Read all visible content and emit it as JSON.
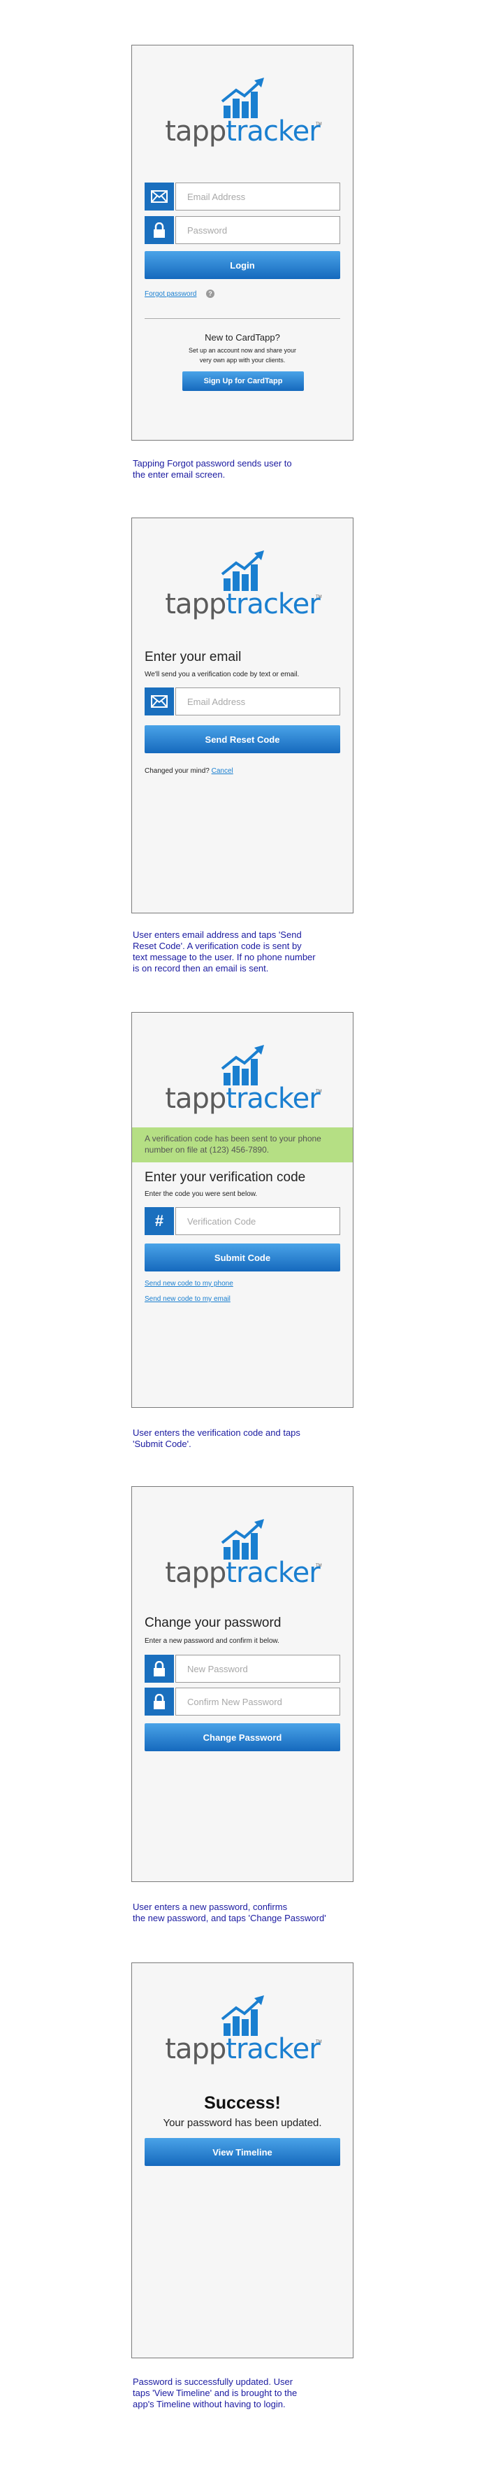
{
  "brand": {
    "part1": "tapp",
    "part2": "tracker",
    "tm": "TM"
  },
  "screen1": {
    "email_placeholder": "Email Address",
    "password_placeholder": "Password",
    "login_label": "Login",
    "forgot_label": "Forgot password",
    "new_title": "New to CardTapp?",
    "new_desc_1": "Set up an account now and share your",
    "new_desc_2": "very own app with your clients.",
    "signup_label": "Sign Up for CardTapp"
  },
  "caption1": "Tapping Forgot password sends user to\nthe enter email screen.",
  "screen2": {
    "heading": "Enter your email",
    "subtext": "We'll send you a verification code by text or email.",
    "email_placeholder": "Email Address",
    "send_label": "Send Reset Code",
    "changed_text": "Changed your mind?",
    "cancel_label": "Cancel"
  },
  "caption2": "User enters email address and taps 'Send\nReset Code'. A verification code is sent by\ntext message to the user. If no phone number\nis on record then an email is sent.",
  "screen3": {
    "banner": "A verification code has been sent to your phone number on file at (123) 456-7890.",
    "heading": "Enter your verification code",
    "subtext": "Enter the code you were sent below.",
    "code_placeholder": "Verification Code",
    "submit_label": "Submit Code",
    "resend_phone": "Send new code to my phone",
    "resend_email": "Send new code to my email"
  },
  "caption3": "User enters the verification code and taps\n'Submit Code'.",
  "screen4": {
    "heading": "Change your password",
    "subtext": "Enter a new password and confirm it below.",
    "new_placeholder": "New Password",
    "confirm_placeholder": "Confirm New Password",
    "change_label": "Change Password"
  },
  "caption4": "User enters a new password, confirms\nthe new password, and taps 'Change Password'",
  "screen5": {
    "title": "Success!",
    "message": "Your password has been updated.",
    "timeline_label": "View Timeline"
  },
  "caption5": "Password is successfully updated. User\ntaps 'View Timeline' and is brought to the\napp's Timeline without having to login.",
  "colors": {
    "accent": "#1a6fbe",
    "brand_blue": "#1a7fd0",
    "banner": "#b5df84",
    "caption": "#1a1aa0"
  }
}
